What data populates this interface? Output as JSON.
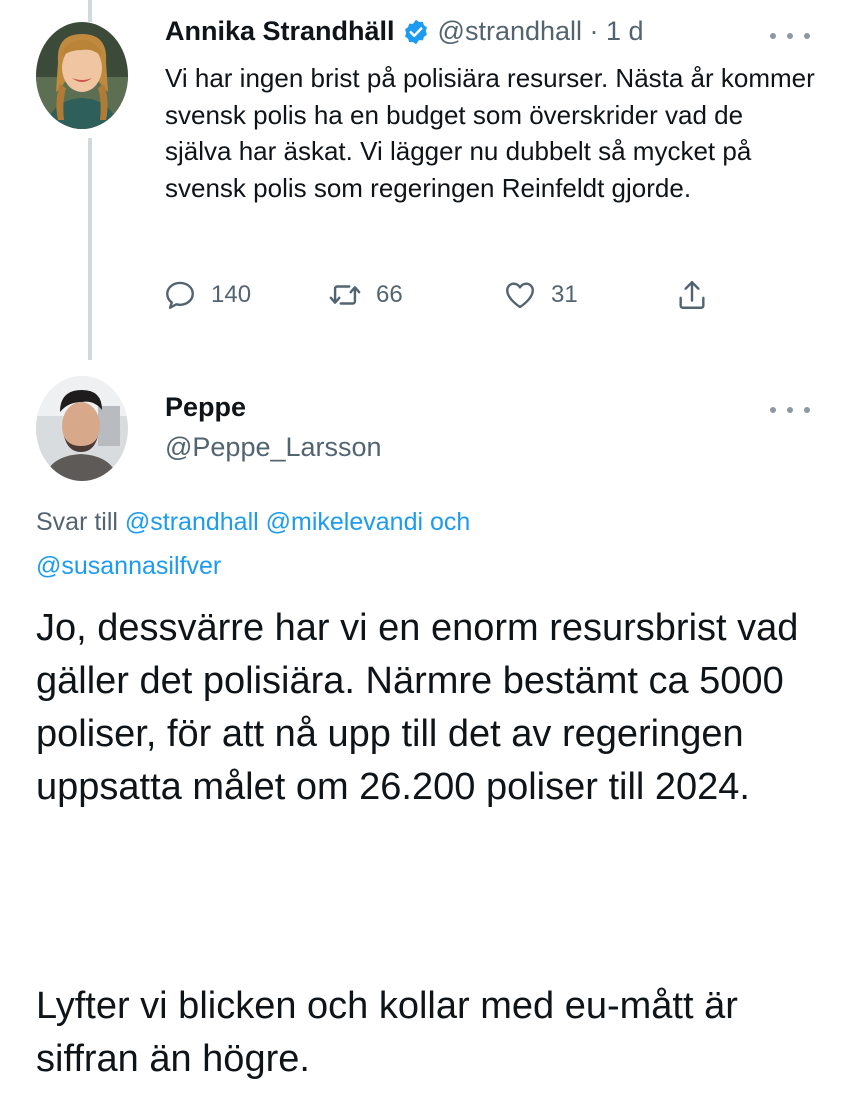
{
  "tweet1": {
    "author_name": "Annika Strandhäll",
    "handle_and_time": "@strandhall · 1 d",
    "text": "Vi har ingen brist på polisiära resurser. Nästa år kommer svensk polis ha en budget som överskrider vad de själva har äskat. Vi lägger nu dubbelt så mycket på svensk polis som regeringen Reinfeldt gjorde.",
    "replies": "140",
    "retweets": "66",
    "likes": "31"
  },
  "tweet2": {
    "author_name": "Peppe",
    "handle": "@Peppe_Larsson",
    "reply_prefix": "Svar till ",
    "mention1": "@strandhall",
    "mention2": "@mikelevandi",
    "reply_joiner": "och",
    "mention3": "@susannasilfver",
    "paragraph1": "Jo, dessvärre har vi en enorm resursbrist vad gäller det polisiära. Närmre bestämt ca 5000 poliser, för att nå upp till det av regeringen uppsatta målet om 26.200 poliser till 2024.",
    "paragraph2": "Lyfter vi blicken och kollar med eu-mått är siffran än högre."
  },
  "colors": {
    "text_primary": "#0f1419",
    "text_secondary": "#536471",
    "link": "#1d9bf0",
    "thread_line": "#cfd9de"
  },
  "icons": [
    "verified-badge-icon",
    "more-options-icon",
    "reply-icon",
    "retweet-icon",
    "like-icon",
    "share-icon"
  ]
}
